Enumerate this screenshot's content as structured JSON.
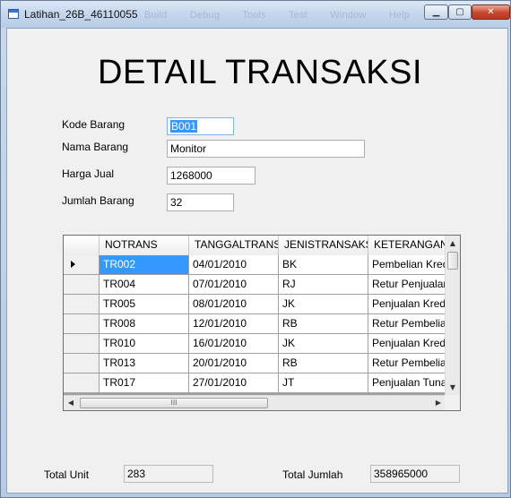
{
  "window": {
    "title": "Latihan_26B_46110055",
    "ghost_menu": [
      "Build",
      "Debug",
      "Tools",
      "Test",
      "Window",
      "Help"
    ],
    "controls": {
      "minimize": "▁",
      "maximize": "▢",
      "close": "✕"
    }
  },
  "heading": "DETAIL TRANSAKSI",
  "form": {
    "kode_label": "Kode Barang",
    "kode_value": "B001",
    "nama_label": "Nama Barang",
    "nama_value": "Monitor",
    "harga_label": "Harga Jual",
    "harga_value": "1268000",
    "jumlah_label": "Jumlah Barang",
    "jumlah_value": "32"
  },
  "grid": {
    "columns": [
      "NOTRANS",
      "TANGGALTRANSAKSI",
      "JENISTRANSAKSI",
      "KETERANGAN"
    ],
    "rows": [
      [
        "TR002",
        "04/01/2010",
        "BK",
        "Pembelian Kredit"
      ],
      [
        "TR004",
        "07/01/2010",
        "RJ",
        "Retur Penjualan"
      ],
      [
        "TR005",
        "08/01/2010",
        "JK",
        "Penjualan Kredit"
      ],
      [
        "TR008",
        "12/01/2010",
        "RB",
        "Retur Pembelian"
      ],
      [
        "TR010",
        "16/01/2010",
        "JK",
        "Penjualan Kredit"
      ],
      [
        "TR013",
        "20/01/2010",
        "RB",
        "Retur Pembelian"
      ],
      [
        "TR017",
        "27/01/2010",
        "JT",
        "Penjualan Tunai"
      ]
    ],
    "selected_row": 0,
    "hscroll_thumb_glyph": "III"
  },
  "totals": {
    "unit_label": "Total Unit",
    "unit_value": "283",
    "jumlah_label": "Total Jumlah",
    "jumlah_value": "358965000"
  }
}
